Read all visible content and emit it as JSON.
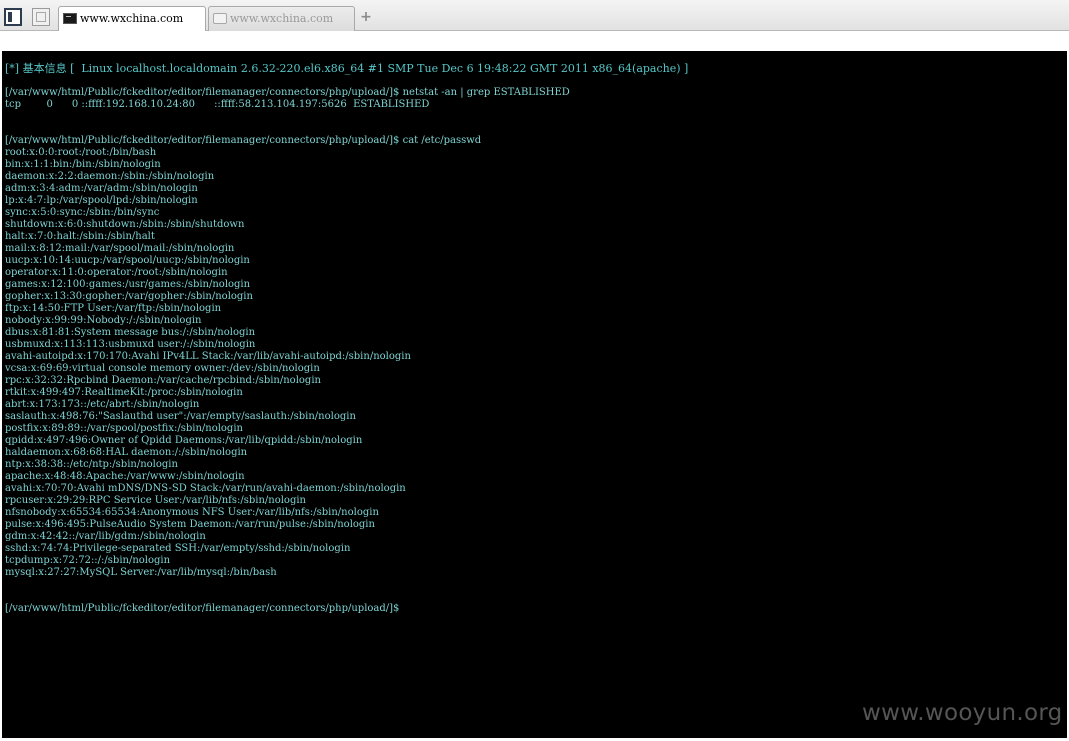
{
  "tabs": [
    {
      "label": "www.wxchina.com",
      "active": true,
      "icon": "terminal-icon"
    },
    {
      "label": "www.wxchina.com",
      "active": false,
      "icon": "page-icon"
    }
  ],
  "new_tab_label": "+",
  "terminal": {
    "lines": [
      "[*] 基本信息 [  Linux localhost.localdomain 2.6.32-220.el6.x86_64 #1 SMP Tue Dec 6 19:48:22 GMT 2011 x86_64(apache) ]",
      "",
      "[/var/www/html/Public/fckeditor/editor/filemanager/connectors/php/upload/]$ netstat -an | grep ESTABLISHED",
      "tcp        0      0 ::ffff:192.168.10.24:80      ::ffff:58.213.104.197:5626  ESTABLISHED",
      "",
      "",
      "[/var/www/html/Public/fckeditor/editor/filemanager/connectors/php/upload/]$ cat /etc/passwd",
      "root:x:0:0:root:/root:/bin/bash",
      "bin:x:1:1:bin:/bin:/sbin/nologin",
      "daemon:x:2:2:daemon:/sbin:/sbin/nologin",
      "adm:x:3:4:adm:/var/adm:/sbin/nologin",
      "lp:x:4:7:lp:/var/spool/lpd:/sbin/nologin",
      "sync:x:5:0:sync:/sbin:/bin/sync",
      "shutdown:x:6:0:shutdown:/sbin:/sbin/shutdown",
      "halt:x:7:0:halt:/sbin:/sbin/halt",
      "mail:x:8:12:mail:/var/spool/mail:/sbin/nologin",
      "uucp:x:10:14:uucp:/var/spool/uucp:/sbin/nologin",
      "operator:x:11:0:operator:/root:/sbin/nologin",
      "games:x:12:100:games:/usr/games:/sbin/nologin",
      "gopher:x:13:30:gopher:/var/gopher:/sbin/nologin",
      "ftp:x:14:50:FTP User:/var/ftp:/sbin/nologin",
      "nobody:x:99:99:Nobody:/:/sbin/nologin",
      "dbus:x:81:81:System message bus:/:/sbin/nologin",
      "usbmuxd:x:113:113:usbmuxd user:/:/sbin/nologin",
      "avahi-autoipd:x:170:170:Avahi IPv4LL Stack:/var/lib/avahi-autoipd:/sbin/nologin",
      "vcsa:x:69:69:virtual console memory owner:/dev:/sbin/nologin",
      "rpc:x:32:32:Rpcbind Daemon:/var/cache/rpcbind:/sbin/nologin",
      "rtkit:x:499:497:RealtimeKit:/proc:/sbin/nologin",
      "abrt:x:173:173::/etc/abrt:/sbin/nologin",
      "saslauth:x:498:76:\"Saslauthd user\":/var/empty/saslauth:/sbin/nologin",
      "postfix:x:89:89::/var/spool/postfix:/sbin/nologin",
      "qpidd:x:497:496:Owner of Qpidd Daemons:/var/lib/qpidd:/sbin/nologin",
      "haldaemon:x:68:68:HAL daemon:/:/sbin/nologin",
      "ntp:x:38:38::/etc/ntp:/sbin/nologin",
      "apache:x:48:48:Apache:/var/www:/sbin/nologin",
      "avahi:x:70:70:Avahi mDNS/DNS-SD Stack:/var/run/avahi-daemon:/sbin/nologin",
      "rpcuser:x:29:29:RPC Service User:/var/lib/nfs:/sbin/nologin",
      "nfsnobody:x:65534:65534:Anonymous NFS User:/var/lib/nfs:/sbin/nologin",
      "pulse:x:496:495:PulseAudio System Daemon:/var/run/pulse:/sbin/nologin",
      "gdm:x:42:42::/var/lib/gdm:/sbin/nologin",
      "sshd:x:74:74:Privilege-separated SSH:/var/empty/sshd:/sbin/nologin",
      "tcpdump:x:72:72::/:/sbin/nologin",
      "mysql:x:27:27:MySQL Server:/var/lib/mysql:/bin/bash",
      "",
      "",
      "[/var/www/html/Public/fckeditor/editor/filemanager/connectors/php/upload/]$"
    ]
  },
  "watermark": "www.wooyun.org",
  "colors": {
    "terminal_bg": "#000000",
    "terminal_fg": "#7fd4d4",
    "heading_fg": "#56c7c7"
  }
}
